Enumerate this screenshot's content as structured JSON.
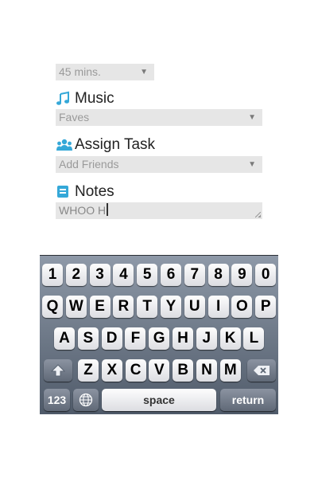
{
  "duration": {
    "value": "45 mins."
  },
  "music": {
    "label": "Music",
    "value": "Faves",
    "icon": "music-note-icon"
  },
  "assign_task": {
    "label": "Assign Task",
    "value": "Add Friends",
    "icon": "people-icon"
  },
  "notes": {
    "label": "Notes",
    "value": "WHOO H",
    "icon": "notepad-icon"
  },
  "keyboard": {
    "row1": [
      "1",
      "2",
      "3",
      "4",
      "5",
      "6",
      "7",
      "8",
      "9",
      "0"
    ],
    "row2": [
      "Q",
      "W",
      "E",
      "R",
      "T",
      "Y",
      "U",
      "I",
      "O",
      "P"
    ],
    "row3": [
      "A",
      "S",
      "D",
      "F",
      "G",
      "H",
      "J",
      "K",
      "L"
    ],
    "row4": [
      "Z",
      "X",
      "C",
      "V",
      "B",
      "N",
      "M"
    ],
    "numbers_label": "123",
    "space_label": "space",
    "return_label": "return"
  },
  "colors": {
    "accent": "#35a8d8",
    "field_bg": "#e6e6e6"
  }
}
